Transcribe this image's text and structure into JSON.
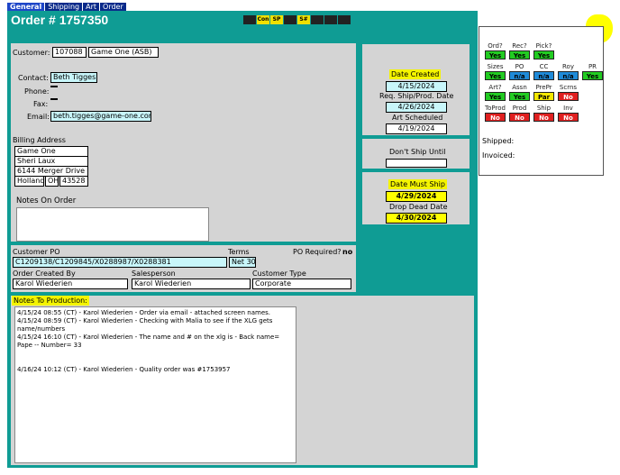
{
  "tabs": [
    "General",
    "Shipping",
    "Art",
    "Order"
  ],
  "order": {
    "title": "Order # 1757350",
    "flags": [
      {
        "label": "",
        "highlight": false
      },
      {
        "label": "Con",
        "highlight": true
      },
      {
        "label": "SP",
        "highlight": true
      },
      {
        "label": "",
        "highlight": false
      },
      {
        "label": "S#",
        "highlight": true
      },
      {
        "label": "",
        "highlight": false
      },
      {
        "label": "",
        "highlight": false
      },
      {
        "label": "",
        "highlight": false
      }
    ]
  },
  "customer": {
    "label": "Customer:",
    "id": "107088",
    "name": "Game One (ASB)",
    "contact_label": "Contact:",
    "contact": "Beth Tigges",
    "phone_label": "Phone:",
    "phone": "",
    "fax_label": "Fax:",
    "fax": "",
    "email_label": "Email:",
    "email": "beth.tigges@game-one.com"
  },
  "billing": {
    "label": "Billing Address",
    "company": "Game One",
    "attn": "Sheri Laux",
    "street": "6144 Merger Drive",
    "city": "Holland",
    "state": "OH",
    "zip": "43528"
  },
  "notes_on_order": {
    "label": "Notes On Order",
    "value": ""
  },
  "dates": {
    "created_label": "Date Created",
    "created": "4/15/2024",
    "req_label": "Req. Ship/Prod. Date",
    "req": "4/26/2024",
    "art_label": "Art Scheduled",
    "art": "4/19/2024",
    "dont_ship_label": "Don't Ship Until",
    "dont_ship": "",
    "must_ship_label": "Date Must Ship",
    "must_ship": "4/29/2024",
    "drop_dead_label": "Drop Dead Date",
    "drop_dead": "4/30/2024"
  },
  "po": {
    "customer_po_label": "Customer PO",
    "customer_po": "C1209138/C1209845/X0288987/X0288381",
    "terms_label": "Terms",
    "terms": "Net 30",
    "po_required_label": "PO Required?",
    "po_required": "no",
    "created_by_label": "Order Created By",
    "created_by": "Karol Wiederien",
    "salesperson_label": "Salesperson",
    "salesperson": "Karol Wiederien",
    "customer_type_label": "Customer Type",
    "customer_type": "Corporate"
  },
  "production": {
    "label": "Notes To Production:",
    "lines": [
      "4/15/24 08:55 (CT) - Karol Wiederien - Order via email - attached screen names.",
      "4/15/24 08:59 (CT) - Karol Wiederien - Checking with Malia to see if the XLG gets name/numbers",
      "4/15/24 16:10 (CT) - Karol Wiederien - The name and # on the xlg is - Back name= Pape -- Number= 33",
      "",
      "",
      "4/16/24 10:12 (CT) - Karol Wiederien - Quality order was #1753957"
    ]
  },
  "status": {
    "rows": [
      [
        {
          "label": "Ord?",
          "value": "Yes",
          "color": "green"
        },
        {
          "label": "Rec?",
          "value": "Yes",
          "color": "green"
        },
        {
          "label": "Pick?",
          "value": "Yes",
          "color": "green"
        }
      ],
      [
        {
          "label": "Sizes",
          "value": "Yes",
          "color": "green"
        },
        {
          "label": "PO",
          "value": "n/a",
          "color": "blue"
        },
        {
          "label": "CC",
          "value": "n/a",
          "color": "blue"
        },
        {
          "label": "Roy",
          "value": "n/a",
          "color": "blue"
        },
        {
          "label": "PR",
          "value": "Yes",
          "color": "green"
        }
      ],
      [
        {
          "label": "Art?",
          "value": "Yes",
          "color": "green"
        },
        {
          "label": "Assn",
          "value": "Yes",
          "color": "green"
        },
        {
          "label": "PrePr",
          "value": "Par",
          "color": "ylw"
        },
        {
          "label": "Scrns",
          "value": "No",
          "color": "red"
        }
      ],
      [
        {
          "label": "ToProd",
          "value": "No",
          "color": "red"
        },
        {
          "label": "Prod",
          "value": "No",
          "color": "red"
        },
        {
          "label": "Ship",
          "value": "No",
          "color": "red"
        },
        {
          "label": "Inv",
          "value": "No",
          "color": "red"
        }
      ]
    ],
    "shipped_label": "Shipped:",
    "invoiced_label": "Invoiced:"
  }
}
